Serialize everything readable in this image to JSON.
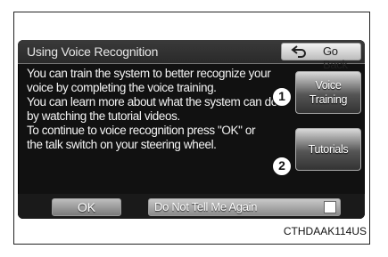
{
  "window": {
    "title": "Using Voice Recognition",
    "back_label": "Go Back"
  },
  "message": {
    "lines": [
      "You can train the system to better recognize your",
      "voice by completing the voice training.",
      "You can learn more about what the system can do",
      "by watching the tutorial videos.",
      "To continue to voice recognition press \"OK\" or",
      "the talk switch on your steering wheel."
    ]
  },
  "buttons": {
    "voice_training_line1": "Voice",
    "voice_training_line2": "Training",
    "tutorials": "Tutorials",
    "ok": "OK",
    "do_not_tell": "Do Not Tell Me Again"
  },
  "checkbox": {
    "do_not_tell_checked": false
  },
  "callouts": {
    "one": "1",
    "two": "2"
  },
  "caption": "CTHDAAK114US",
  "icons": {
    "back": "back-arrow-icon"
  },
  "colors": {
    "screen_bg": "#111111",
    "text": "#f4f4f4",
    "button_light": "#d9d9d9",
    "button_dark": "#333333"
  }
}
